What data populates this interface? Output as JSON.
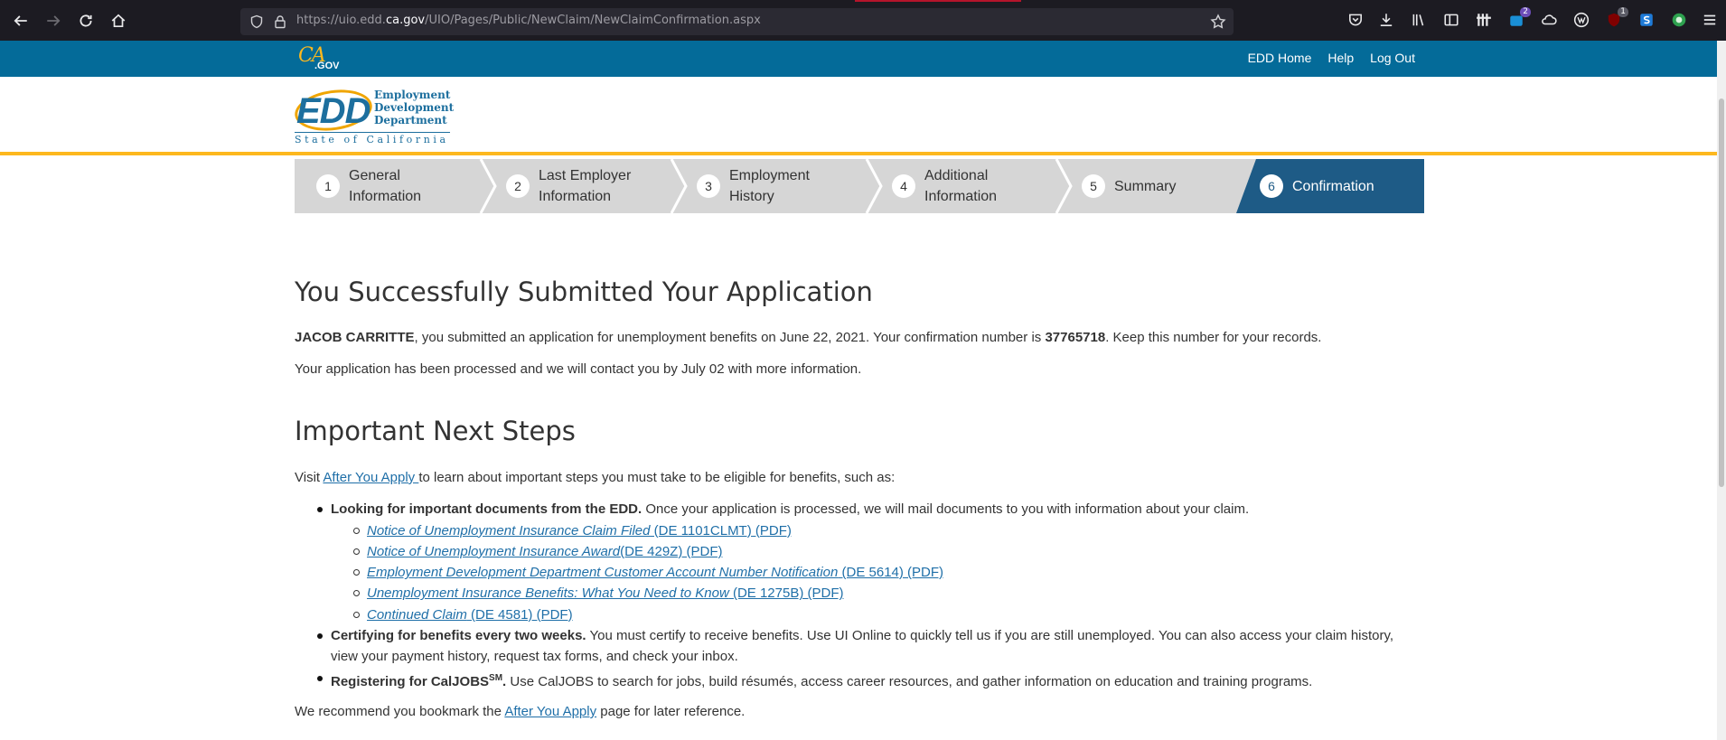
{
  "browser": {
    "url_prefix": "https://uio.edd.",
    "url_domain": "ca.gov",
    "url_path": "/UIO/Pages/Public/NewClaim/NewClaimConfirmation.aspx",
    "badge_extension_count": "2",
    "badge_ublock_count": "1"
  },
  "utility": {
    "logo_ca": "CA",
    "logo_gov": ".GOV",
    "links": [
      "EDD Home",
      "Help",
      "Log Out"
    ]
  },
  "logo": {
    "edd": "EDD",
    "line1": "Employment",
    "line2": "Development",
    "line3": "Department",
    "state": "State of California"
  },
  "steps": [
    {
      "num": "1",
      "label_line1": "General",
      "label_line2": "Information"
    },
    {
      "num": "2",
      "label_line1": "Last Employer",
      "label_line2": "Information"
    },
    {
      "num": "3",
      "label_line1": "Employment",
      "label_line2": "History"
    },
    {
      "num": "4",
      "label_line1": "Additional",
      "label_line2": "Information"
    },
    {
      "num": "5",
      "label_line1": "Summary",
      "label_line2": ""
    },
    {
      "num": "6",
      "label_line1": "Confirmation",
      "label_line2": ""
    }
  ],
  "main": {
    "title": "You Successfully Submitted Your Application",
    "p1_name": "JACOB CARRITTE",
    "p1_text_a": ", you submitted an application for unemployment benefits on June 22, 2021. Your confirmation number is ",
    "p1_confirmation": "37765718",
    "p1_text_b": ". Keep this number for your records.",
    "p2": "Your application has been processed and we will contact you by July 02 with more information.",
    "next_title": "Important Next Steps",
    "visit_a": "Visit ",
    "visit_link": "After You Apply ",
    "visit_b": "to learn about important steps you must take to be eligible for benefits, such as:",
    "bullet1_bold": "Looking for important documents from the EDD.",
    "bullet1_text": " Once your application is processed, we will mail documents to you with information about your claim.",
    "documents": [
      {
        "title": "Notice of Unemployment Insurance Claim Filed",
        "code": " (DE 1101CLMT) (PDF)"
      },
      {
        "title": "Notice of Unemployment Insurance Award",
        "code": "(DE 429Z) (PDF)"
      },
      {
        "title": "Employment Development Department Customer Account Number Notification",
        "code": " (DE 5614) (PDF)"
      },
      {
        "title": "Unemployment Insurance Benefits: What You Need to Know",
        "code": " (DE 1275B) (PDF)"
      },
      {
        "title": "Continued Claim",
        "code": " (DE 4581) (PDF)"
      }
    ],
    "bullet2_bold": "Certifying for benefits every two weeks.",
    "bullet2_text": " You must certify to receive benefits. Use UI Online to quickly tell us if you are still unemployed. You can also access your claim history, view your payment history, request tax forms, and check your inbox.",
    "bullet3_bold": "Registering for CalJOBS",
    "bullet3_sup": "SM",
    "bullet3_dot": ".",
    "bullet3_text": " Use CalJOBS to search for jobs, build résumés, access career resources, and gather information on education and training programs.",
    "bookmark_a": "We recommend you bookmark the ",
    "bookmark_link": "After You Apply",
    "bookmark_b": " page for later reference."
  }
}
